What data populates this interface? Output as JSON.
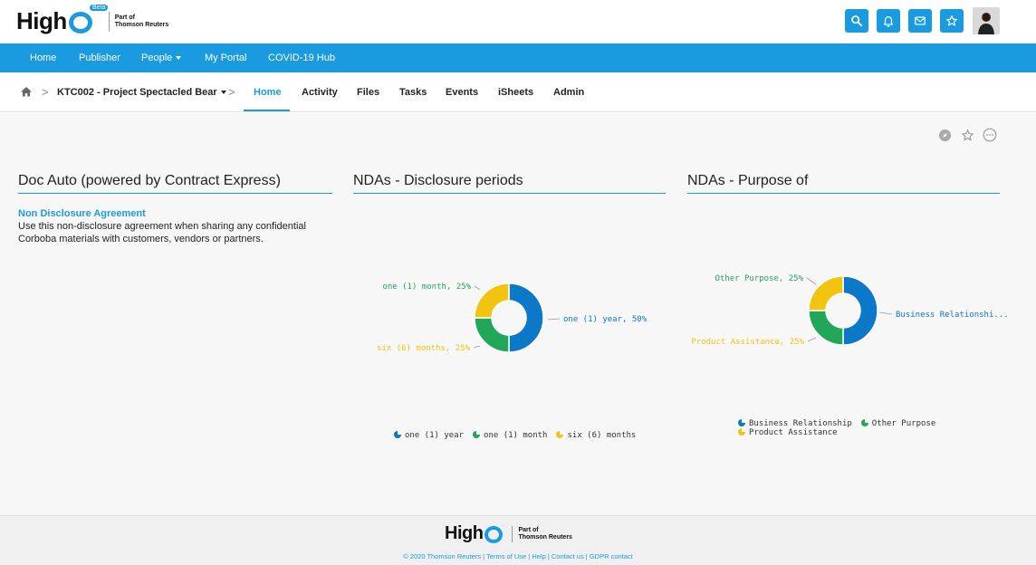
{
  "header": {
    "logo_text": "High",
    "beta_label": "Beta",
    "logo_sub_line1": "Part of",
    "logo_sub_line2": "Thomson Reuters",
    "icons": [
      "search-icon",
      "bell-icon",
      "mail-icon",
      "star-icon"
    ],
    "accent_color": "#1a9be0"
  },
  "topnav": {
    "items": [
      {
        "label": "Home"
      },
      {
        "label": "Publisher"
      },
      {
        "label": "People"
      },
      {
        "label": "My Portal"
      },
      {
        "label": "COVID-19 Hub"
      }
    ]
  },
  "subnav": {
    "project": "KTC002 - Project Spectacled Bear",
    "tabs": [
      {
        "label": "Home",
        "active": true
      },
      {
        "label": "Activity"
      },
      {
        "label": "Files"
      },
      {
        "label": "Tasks"
      },
      {
        "label": "Events"
      },
      {
        "label": "iSheets"
      },
      {
        "label": "Admin"
      }
    ]
  },
  "toolbar_icons": [
    "compass-icon",
    "star-outline-icon",
    "more-icon"
  ],
  "panels": {
    "doc": {
      "title": "Doc Auto (powered by Contract Express)",
      "link": "Non Disclosure Agreement",
      "description": "Use this non-disclosure agreement when sharing any confidential Corboba materials with customers, vendors or partners."
    },
    "disclosure": {
      "title": "NDAs - Disclosure periods"
    },
    "purpose": {
      "title": "NDAs - Purpose of"
    }
  },
  "chart_data": [
    {
      "type": "pie",
      "title": "NDAs - Disclosure periods",
      "categories": [
        "one (1) year",
        "one (1) month",
        "six (6) months"
      ],
      "values": [
        50,
        25,
        25
      ],
      "colors": [
        "#0b78c8",
        "#21a65a",
        "#f2c30f"
      ],
      "labels": [
        "one (1) year, 50%",
        "one (1) month, 25%",
        "six (6) months, 25%"
      ],
      "legend": "bottom"
    },
    {
      "type": "pie",
      "title": "NDAs - Purpose of",
      "categories": [
        "Business Relationship",
        "Other Purpose",
        "Product Assistance"
      ],
      "values": [
        50,
        25,
        25
      ],
      "colors": [
        "#0b78c8",
        "#21a65a",
        "#f2c30f"
      ],
      "labels": [
        "Business Relationshi...",
        "Other Purpose, 25%",
        "Product Assistance, 25%"
      ],
      "legend": "bottom"
    }
  ],
  "footer": {
    "logo_text": "High",
    "logo_sub_line1": "Part of",
    "logo_sub_line2": "Thomson Reuters",
    "links": "© 2020 Thomson Reuters | Terms of Use | Help | Contact us | GDPR contact"
  }
}
